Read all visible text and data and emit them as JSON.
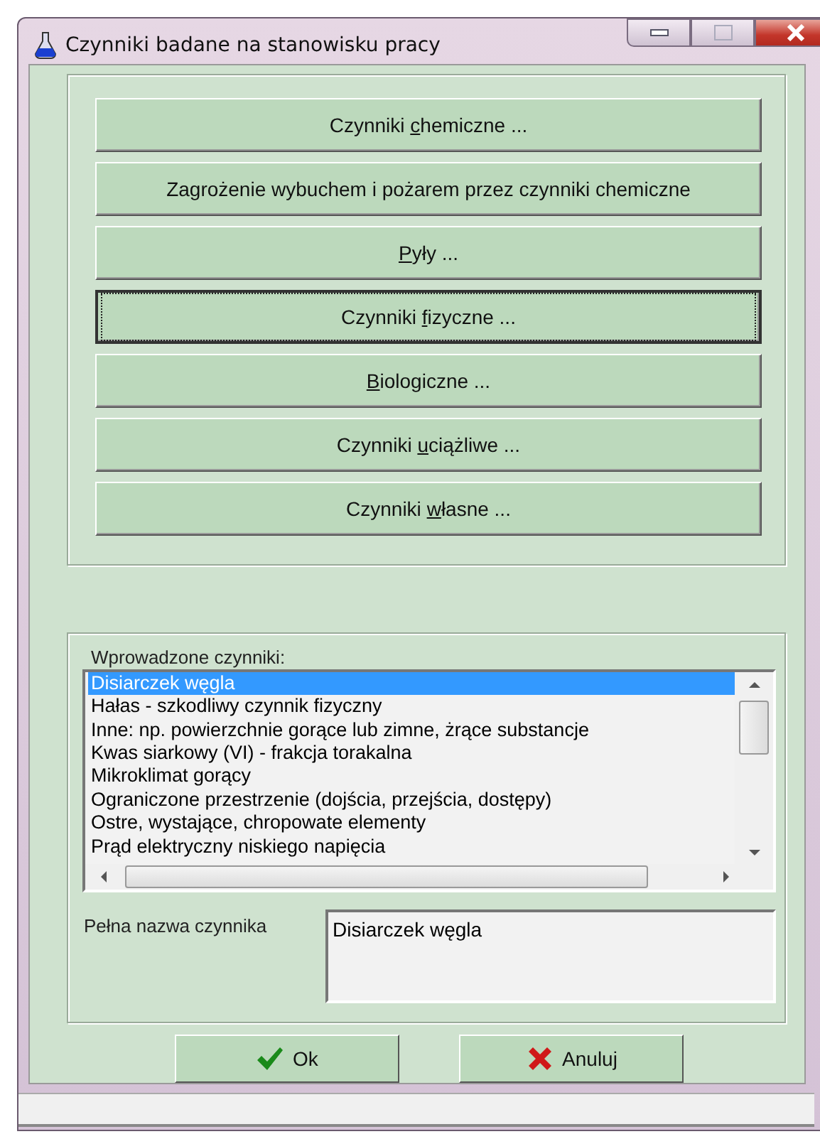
{
  "window": {
    "title": "Czynniki badane na stanowisku pracy"
  },
  "factor_buttons": [
    {
      "before": "Czynniki ",
      "key": "c",
      "after": "hemiczne ...",
      "focused": false
    },
    {
      "before": "Zagrożenie wybuchem i pożarem przez czynniki chemiczne",
      "focused": false
    },
    {
      "key": "P",
      "after": "yły ...",
      "focused": false
    },
    {
      "before": "Czynniki ",
      "key": "f",
      "after": "izyczne ...",
      "focused": true
    },
    {
      "key": "B",
      "after": "iologiczne ...",
      "focused": false
    },
    {
      "before": "Czynniki ",
      "key": "u",
      "after": "ciążliwe ...",
      "focused": false
    },
    {
      "before": "Czynniki ",
      "key": "w",
      "after": "łasne ...",
      "focused": false
    }
  ],
  "entered": {
    "label": "Wprowadzone czynniki:",
    "items": [
      {
        "text": "Disiarczek węgla",
        "selected": true
      },
      {
        "text": "Hałas - szkodliwy czynnik fizyczny",
        "selected": false
      },
      {
        "text": "Inne: np. powierzchnie gorące lub zimne, żrące substancje",
        "selected": false
      },
      {
        "text": "Kwas siarkowy (VI) -  frakcja torakalna",
        "selected": false
      },
      {
        "text": "Mikroklimat gorący",
        "selected": false
      },
      {
        "text": "Ograniczone przestrzenie (dojścia, przejścia, dostępy)",
        "selected": false
      },
      {
        "text": "Ostre, wystające, chropowate elementy",
        "selected": false
      },
      {
        "text": "Prąd elektryczny niskiego napięcia",
        "selected": false
      }
    ]
  },
  "full_name": {
    "label": "Pełna nazwa czynnika",
    "value": "Disiarczek węgla"
  },
  "buttons": [
    {
      "kind": "ok",
      "label": "Ok"
    },
    {
      "kind": "cancel",
      "label": "Anuluj"
    }
  ]
}
